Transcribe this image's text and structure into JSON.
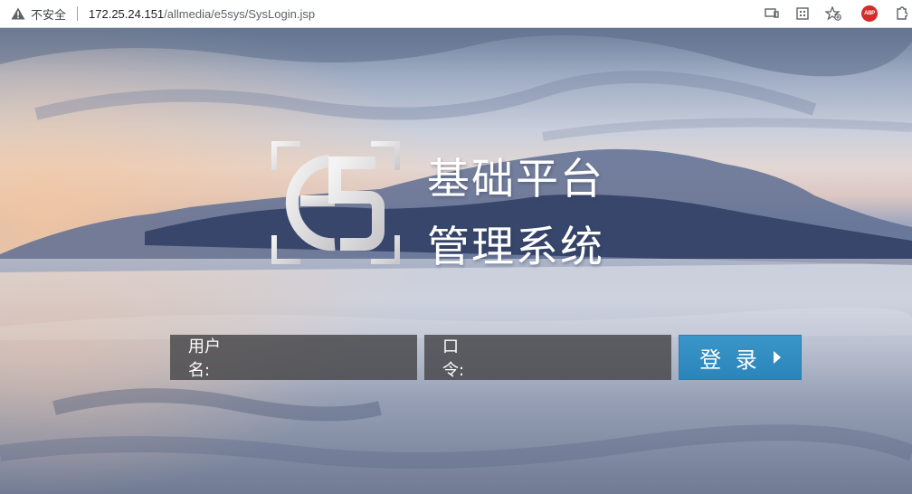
{
  "browser": {
    "security_label": "不安全",
    "url_host": "172.25.24.151",
    "url_path": "/allmedia/e5sys/SysLogin.jsp",
    "icons": [
      "warning-icon",
      "cast-icon",
      "grid-icon",
      "star-add-icon",
      "adblock-plus-icon",
      "extensions-icon"
    ],
    "abp_label": "ABP"
  },
  "logo": {
    "icon": "e5-logo-icon"
  },
  "title": {
    "line1": "基础平台",
    "line2": "管理系统"
  },
  "login": {
    "username_label": "用户名:",
    "password_label": "口令:",
    "username_value": "",
    "password_value": "",
    "submit_label": "登 录"
  }
}
